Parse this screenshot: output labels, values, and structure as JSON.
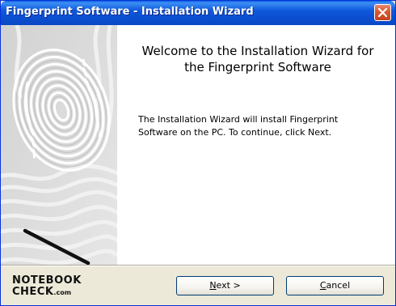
{
  "window": {
    "title": "Fingerprint Software - Installation Wizard"
  },
  "welcome": {
    "heading_line1": "Welcome to the Installation Wizard for",
    "heading_line2": "the Fingerprint Software",
    "description_line1": "The Installation Wizard will install Fingerprint",
    "description_line2": "Software on the PC. To continue, click Next."
  },
  "buttons": {
    "next": {
      "mnemonic": "N",
      "rest": "ext >"
    },
    "cancel": {
      "mnemonic": "C",
      "rest": "ancel"
    }
  },
  "watermark": {
    "line1": "NOTEBOOK",
    "line2": "CHECK",
    "suffix": ".com"
  },
  "icons": {
    "close": "close-x-icon",
    "fingerprint": "fingerprint-graphic"
  },
  "colors": {
    "titlebar": "#0b4fd0",
    "close": "#d8582f",
    "frame": "#ece9d8",
    "button_border": "#003c74"
  }
}
